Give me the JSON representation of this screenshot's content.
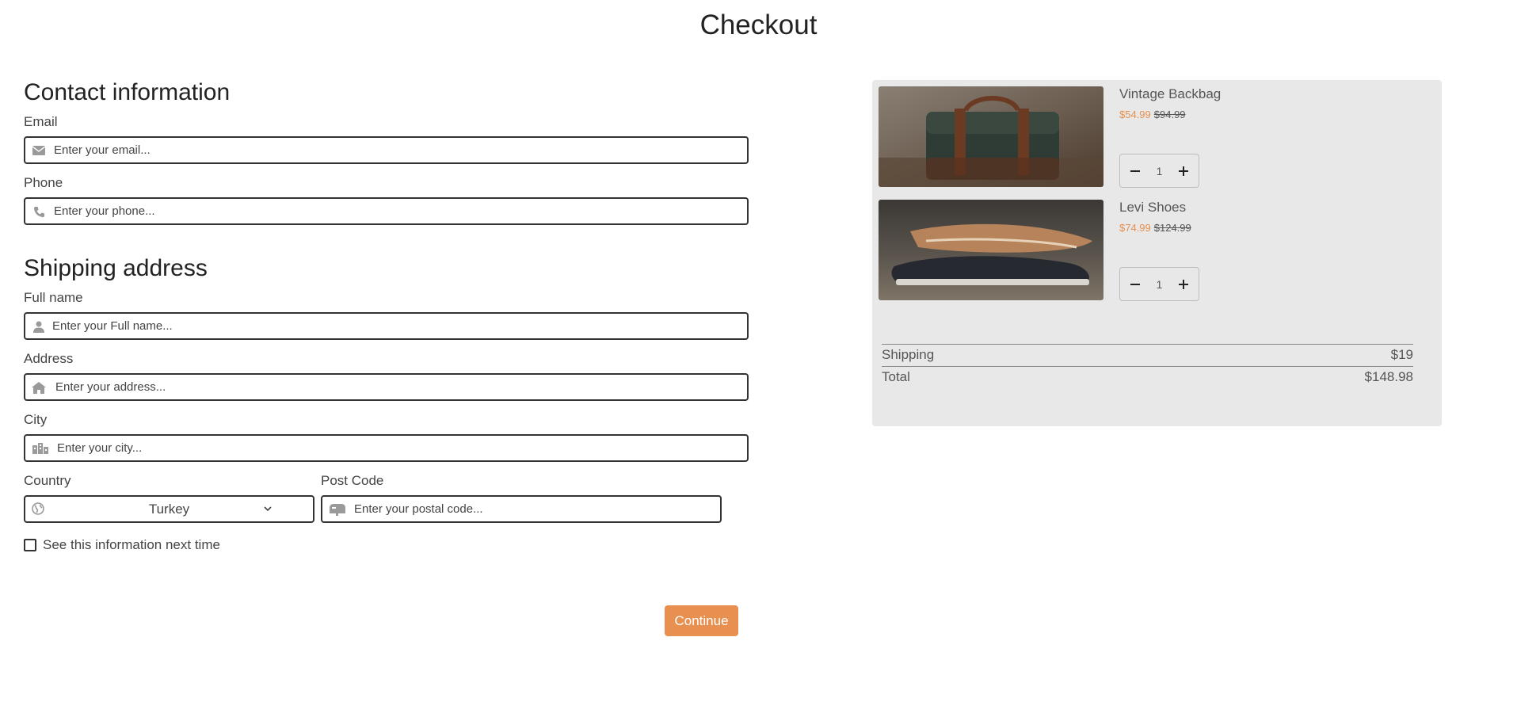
{
  "page": {
    "title": "Checkout"
  },
  "contact": {
    "title": "Contact information",
    "email": {
      "label": "Email",
      "placeholder": "Enter your email...",
      "icon": "envelope-icon"
    },
    "phone": {
      "label": "Phone",
      "placeholder": "Enter your phone...",
      "icon": "phone-icon"
    }
  },
  "shipping": {
    "title": "Shipping address",
    "full_name": {
      "label": "Full name",
      "placeholder": "Enter your Full name...",
      "icon": "user-icon"
    },
    "address": {
      "label": "Address",
      "placeholder": "Enter your address...",
      "icon": "home-icon"
    },
    "city": {
      "label": "City",
      "placeholder": "Enter your city...",
      "icon": "city-icon"
    },
    "country": {
      "label": "Country",
      "value": "Turkey",
      "icon": "globe-icon"
    },
    "post_code": {
      "label": "Post Code",
      "placeholder": "Enter your postal code...",
      "icon": "mailbox-icon"
    },
    "remember": {
      "label": "See this information next time",
      "checked": false
    }
  },
  "actions": {
    "continue_label": "Continue"
  },
  "cart": {
    "items": [
      {
        "name": "Vintage Backbag",
        "price": "$54.99",
        "old_price": "$94.99",
        "quantity": "1"
      },
      {
        "name": "Levi Shoes",
        "price": "$74.99",
        "old_price": "$124.99",
        "quantity": "1"
      }
    ],
    "shipping_label": "Shipping",
    "shipping_value": "$19",
    "total_label": "Total",
    "total_value": "$148.98"
  },
  "colors": {
    "accent": "#e7904f",
    "panel": "#e8e8e8",
    "text": "#333333"
  }
}
